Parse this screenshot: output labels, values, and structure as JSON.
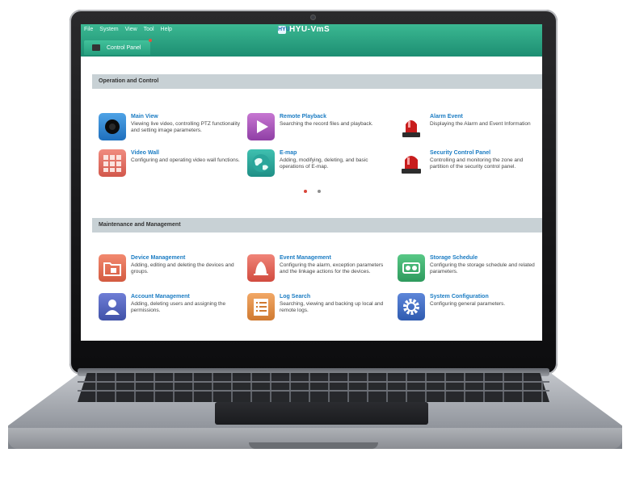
{
  "menu": [
    "File",
    "System",
    "View",
    "Tool",
    "Help"
  ],
  "app": {
    "title": "HYU-VmS",
    "logo": "HYU"
  },
  "tab": {
    "label": "Control Panel"
  },
  "sections": {
    "operation": "Operation and Control",
    "maintenance": "Maintenance and Management"
  },
  "operation_items": [
    {
      "title": "Main View",
      "desc": "Viewing live video, controlling PTZ functionality and setting image parameters.",
      "icon": "camera-view-icon"
    },
    {
      "title": "Remote Playback",
      "desc": "Searching the record files and playback.",
      "icon": "play-icon"
    },
    {
      "title": "Alarm Event",
      "desc": "Displaying the Alarm and Event Information",
      "icon": "alarm-siren-icon"
    },
    {
      "title": "Video Wall",
      "desc": "Configuring and operating video wall functions.",
      "icon": "video-wall-grid-icon"
    },
    {
      "title": "E-map",
      "desc": "Adding, modifying, deleting, and basic operations of E-map.",
      "icon": "map-icon"
    },
    {
      "title": "Security Control Panel",
      "desc": "Controlling and monitoring the zone and partition of the security control panel.",
      "icon": "security-siren-icon"
    }
  ],
  "maintenance_items": [
    {
      "title": "Device Management",
      "desc": "Adding, editing and deleting the devices and groups.",
      "icon": "device-folder-icon"
    },
    {
      "title": "Event Management",
      "desc": "Configuring the alarm, exception parameters and the linkage actions for the devices.",
      "icon": "bell-icon"
    },
    {
      "title": "Storage Schedule",
      "desc": "Configuring the storage schedule and related parameters.",
      "icon": "storage-icon"
    },
    {
      "title": "Account Management",
      "desc": "Adding, deleting users and assigning the permissions.",
      "icon": "user-icon"
    },
    {
      "title": "Log Search",
      "desc": "Searching, viewing and backing up local and remote logs.",
      "icon": "log-list-icon"
    },
    {
      "title": "System Configuration",
      "desc": "Configuring general parameters.",
      "icon": "gear-icon"
    }
  ],
  "colors": {
    "titlebar": "#1d8e72",
    "section_bg": "#c8d1d5",
    "link_title": "#1b7cc3",
    "pager_active": "#d9463a",
    "pager_inactive": "#8f8f8f"
  }
}
